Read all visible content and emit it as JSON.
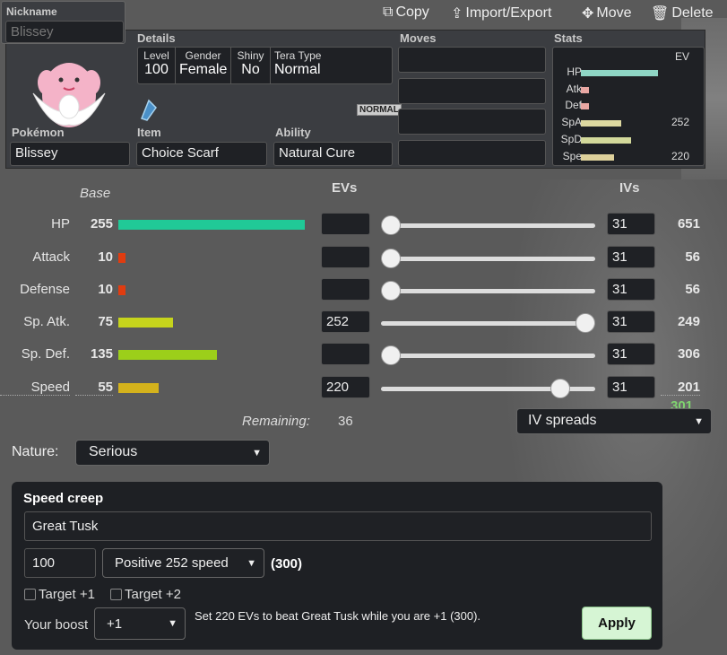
{
  "nickname": {
    "label": "Nickname",
    "placeholder": "Blissey"
  },
  "toolbar": {
    "copy": "Copy",
    "import_export": "Import/Export",
    "move": "Move",
    "delete": "Delete"
  },
  "details": {
    "title": "Details",
    "level_h": "Level",
    "level": "100",
    "gender_h": "Gender",
    "gender": "Female",
    "shiny_h": "Shiny",
    "shiny": "No",
    "tera_h": "Tera Type",
    "tera": "Normal",
    "type_badge": "NORMAL"
  },
  "pokemon": {
    "label": "Pokémon",
    "value": "Blissey"
  },
  "item": {
    "label": "Item",
    "value": "Choice Scarf"
  },
  "ability": {
    "label": "Ability",
    "value": "Natural Cure"
  },
  "moves": {
    "label": "Moves",
    "items": [
      "",
      "",
      "",
      ""
    ]
  },
  "stats_mini": {
    "label": "Stats",
    "ev_header": "EV",
    "rows": [
      {
        "name": "HP",
        "ev": ""
      },
      {
        "name": "Atk",
        "ev": ""
      },
      {
        "name": "Def",
        "ev": ""
      },
      {
        "name": "SpA",
        "ev": "252"
      },
      {
        "name": "SpD",
        "ev": ""
      },
      {
        "name": "Spe",
        "ev": "220"
      }
    ]
  },
  "headers": {
    "base": "Base",
    "evs": "EVs",
    "ivs": "IVs"
  },
  "stats": [
    {
      "name": "HP",
      "base": "255",
      "ev": "",
      "iv": "31",
      "total": "651",
      "ev_value": 0,
      "color": "#20c997"
    },
    {
      "name": "Attack",
      "base": "10",
      "ev": "",
      "iv": "31",
      "total": "56",
      "ev_value": 0,
      "color": "#e03c10"
    },
    {
      "name": "Defense",
      "base": "10",
      "ev": "",
      "iv": "31",
      "total": "56",
      "ev_value": 0,
      "color": "#e03c10"
    },
    {
      "name": "Sp. Atk.",
      "base": "75",
      "ev": "252",
      "iv": "31",
      "total": "249",
      "ev_value": 252,
      "color": "#c6d41c"
    },
    {
      "name": "Sp. Def.",
      "base": "135",
      "ev": "",
      "iv": "31",
      "total": "306",
      "ev_value": 0,
      "color": "#9ccf1a"
    },
    {
      "name": "Speed",
      "base": "55",
      "ev": "220",
      "iv": "31",
      "total": "201",
      "ev_value": 220,
      "color": "#d4b21c"
    }
  ],
  "speed_extra": "301",
  "remaining": {
    "label": "Remaining:",
    "value": "36"
  },
  "iv_spreads": "IV spreads",
  "nature": {
    "label": "Nature:",
    "value": "Serious"
  },
  "speed_creep": {
    "title": "Speed creep",
    "target_name": "Great Tusk",
    "level": "100",
    "preset": "Positive 252 speed",
    "preset_stat": "(300)",
    "target_plus1": "Target +1",
    "target_plus2": "Target +2",
    "boost_label": "Your boost",
    "boost_value": "+1",
    "message": "Set 220 EVs to beat Great Tusk while you are +1 (300).",
    "apply": "Apply"
  }
}
